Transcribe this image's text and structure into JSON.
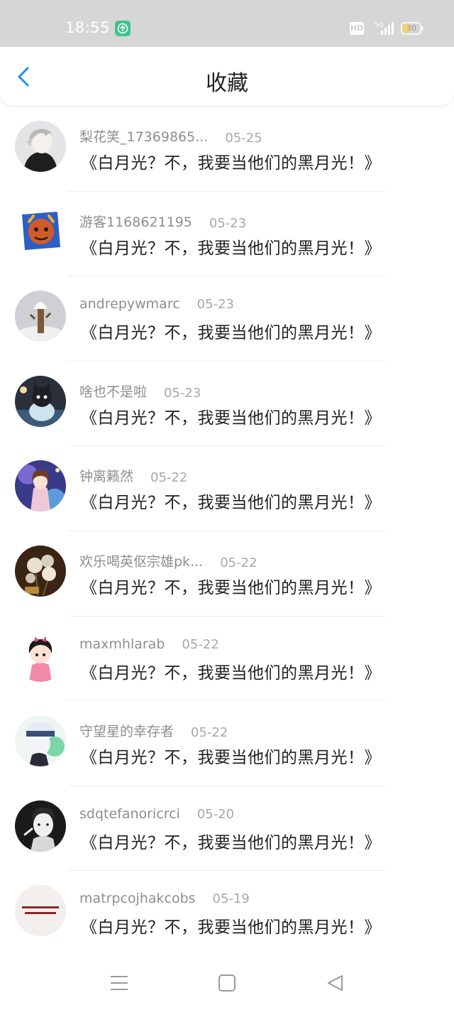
{
  "status_bar": {
    "time": "18:55",
    "hd_label": "HD",
    "network_label": "5G",
    "battery_level": "30"
  },
  "header": {
    "title": "收藏",
    "back_icon": "chevron-left-icon"
  },
  "favorites": [
    {
      "user": "梨花笑_17369865...",
      "date": "05-25",
      "title": "《白月光？不，我要当他们的黑月光！》"
    },
    {
      "user": "游客1168621195",
      "date": "05-23",
      "title": "《白月光？不，我要当他们的黑月光！》"
    },
    {
      "user": "andrepywmarc",
      "date": "05-23",
      "title": "《白月光？不，我要当他们的黑月光！》"
    },
    {
      "user": "啥也不是啦",
      "date": "05-23",
      "title": "《白月光？不，我要当他们的黑月光！》"
    },
    {
      "user": "钟离籁然",
      "date": "05-22",
      "title": "《白月光？不，我要当他们的黑月光！》"
    },
    {
      "user": "欢乐喝英伛宗雄pk...",
      "date": "05-22",
      "title": "《白月光？不，我要当他们的黑月光！》"
    },
    {
      "user": "maxmhlarab",
      "date": "05-22",
      "title": "《白月光？不，我要当他们的黑月光！》"
    },
    {
      "user": "守望星的幸存者",
      "date": "05-22",
      "title": "《白月光？不，我要当他们的黑月光！》"
    },
    {
      "user": "sdqtefanoricrci",
      "date": "05-20",
      "title": "《白月光？不，我要当他们的黑月光！》"
    },
    {
      "user": "matrpcojhakcobs",
      "date": "05-19",
      "title": "《白月光？不，我要当他们的黑月光！》"
    }
  ],
  "colors": {
    "accent": "#1e8ff0",
    "status_bar_bg": "#d6d6d6",
    "notification_green": "#3cc48b"
  },
  "nav_icons": [
    "menu-icon",
    "home-square-icon",
    "back-triangle-icon"
  ]
}
